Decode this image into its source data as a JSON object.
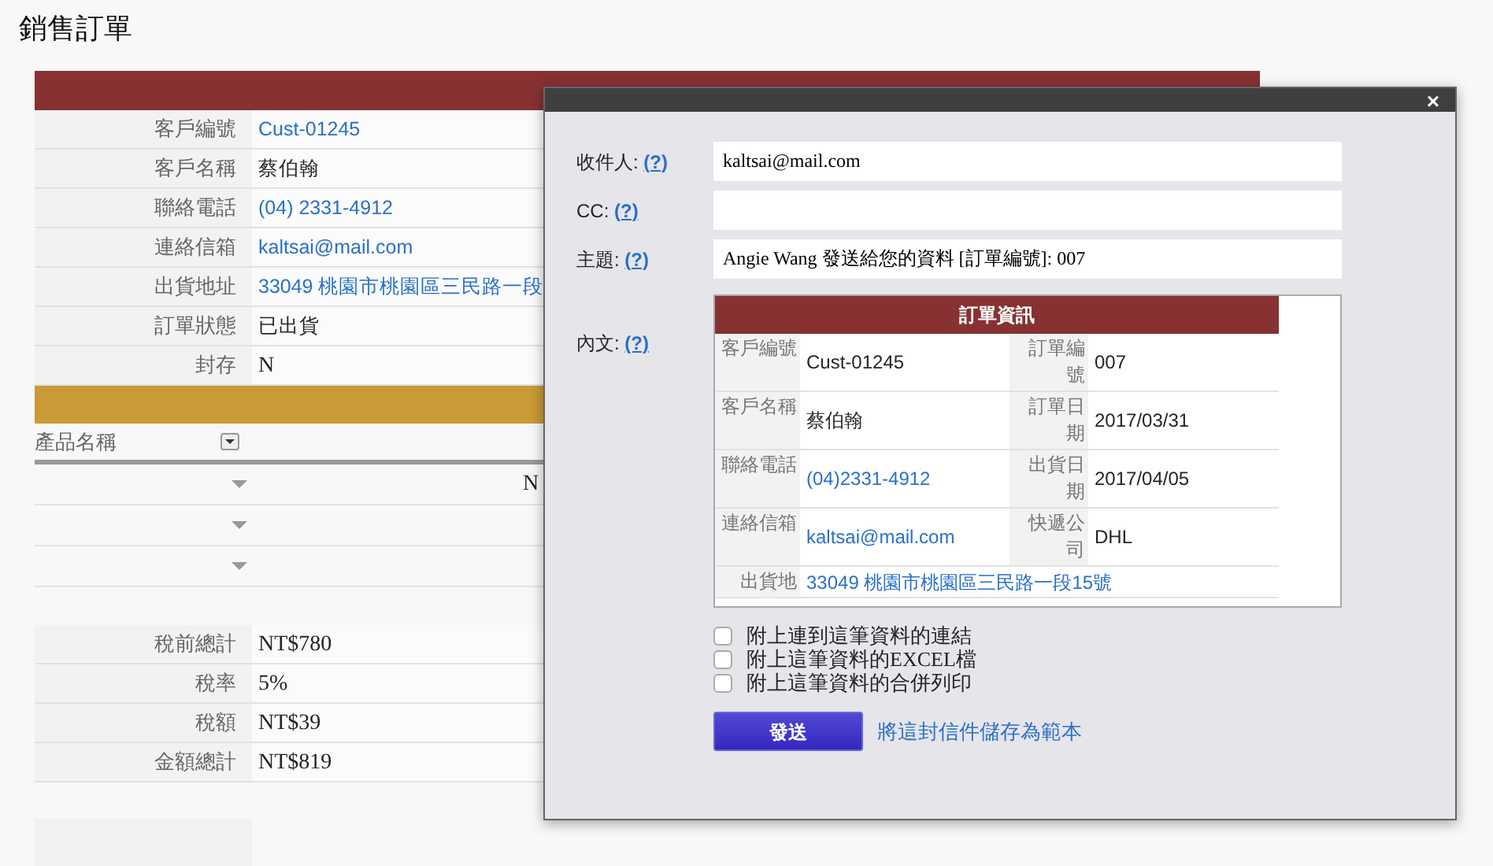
{
  "page_title": "銷售訂單",
  "order_section": {
    "fields": [
      {
        "label": "客戶編號",
        "value": "Cust-01245",
        "kind": "link"
      },
      {
        "label": "客戶名稱",
        "value": "蔡伯翰",
        "kind": "text"
      },
      {
        "label": "聯絡電話",
        "value": "(04) 2331-4912",
        "kind": "link"
      },
      {
        "label": "連絡信箱",
        "value": "kaltsai@mail.com",
        "kind": "link"
      },
      {
        "label": "出貨地址",
        "value": "33049 桃園市桃園區三民路一段",
        "kind": "link"
      },
      {
        "label": "訂單狀態",
        "value": "已出貨",
        "kind": "text"
      },
      {
        "label": "封存",
        "value": "N",
        "kind": "serif"
      }
    ]
  },
  "products": {
    "columns": [
      "產品名稱"
    ],
    "rows": [
      {
        "column_2": "N",
        "dropdown": true
      },
      {
        "dropdown": true
      },
      {
        "dropdown": true
      }
    ]
  },
  "totals": [
    {
      "label": "稅前總計",
      "value": "NT$780"
    },
    {
      "label": "稅率",
      "value": "5%"
    },
    {
      "label": "稅額",
      "value": "NT$39"
    },
    {
      "label": "金額總計",
      "value": "NT$819"
    }
  ],
  "dialog": {
    "close": "×",
    "fields": [
      {
        "label": "收件人:",
        "help": "(?)",
        "value": "kaltsai@mail.com"
      },
      {
        "label": "CC:",
        "help": "(?)"
      },
      {
        "label": "主題:",
        "help": "(?)",
        "value": "Angie Wang 發送給您的資料 [訂單編號]: 007"
      }
    ],
    "body": {
      "label": "內文:",
      "help": "(?)",
      "title": "訂單資訊",
      "rows": [
        [
          {
            "label": "客戶編號",
            "value": "Cust-01245",
            "kind": "text"
          },
          {
            "label": "訂單編號",
            "value": "007",
            "kind": "text"
          }
        ],
        [
          {
            "label": "客戶名稱",
            "value": "蔡伯翰",
            "kind": "text"
          },
          {
            "label": "訂單日期",
            "value": "2017/03/31",
            "kind": "text"
          }
        ],
        [
          {
            "label": "聯絡電話",
            "value": "(04)2331-4912",
            "kind": "link"
          },
          {
            "label": "出貨日期",
            "value": "2017/04/05",
            "kind": "text"
          }
        ],
        [
          {
            "label": "連絡信箱",
            "value": "kaltsai@mail.com",
            "kind": "link"
          },
          {
            "label": "快遞公司",
            "value": "DHL",
            "kind": "text"
          }
        ],
        [
          {
            "label": "出貨地",
            "value": "33049 桃園市桃園區三民路一段15號",
            "kind": "link"
          }
        ]
      ]
    },
    "options": [
      {
        "label": "附上連到這筆資料的連結",
        "checked": false
      },
      {
        "label": "附上這筆資料的EXCEL檔",
        "checked": false
      },
      {
        "label": "附上這筆資料的合併列印",
        "checked": false
      }
    ],
    "send_button": "發送",
    "save_template_link": "將這封信件儲存為範本"
  }
}
